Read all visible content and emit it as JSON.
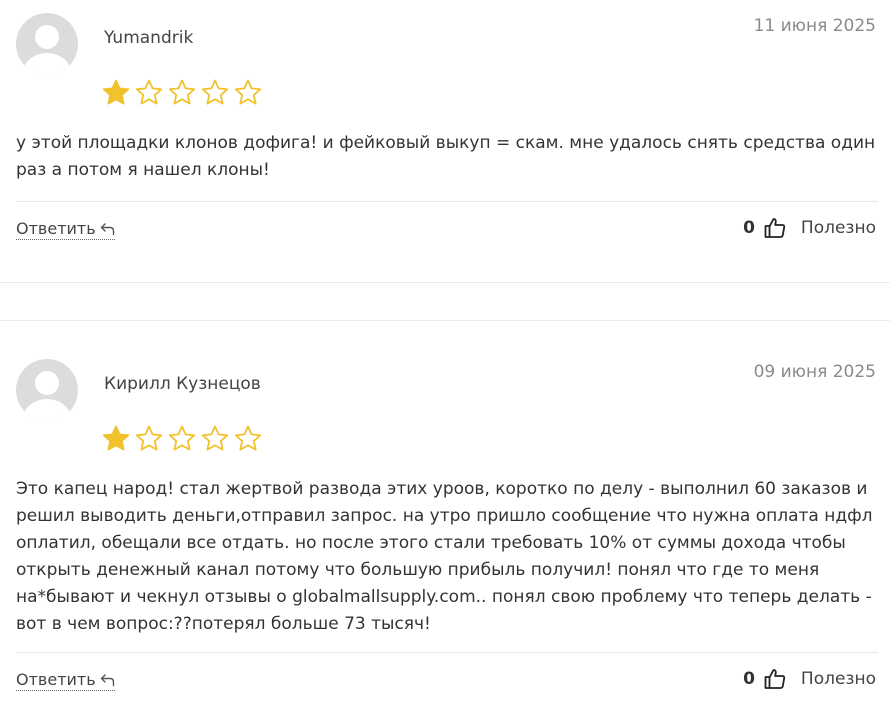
{
  "reviews": [
    {
      "author": "Yumandrik",
      "date": "11 июня 2025",
      "rating": 1,
      "max_rating": 5,
      "text": "у этой площадки клонов дофига! и фейковый выкуп = скам. мне удалось снять средства один раз а потом я нашел клоны!",
      "reply_label": "Ответить",
      "likes": "0",
      "useful_label": "Полезно"
    },
    {
      "author": "Кирилл Кузнецов",
      "date": "09 июня 2025",
      "rating": 1,
      "max_rating": 5,
      "text": "Это капец народ! стал жертвой развода этих уроов, коротко по делу - выполнил 60 заказов и решил выводить деньги,отправил запрос. на утро пришло сообщение что нужна оплата ндфл оплатил, обещали все отдать. но после этого стали требовать 10% от суммы дохода чтобы открыть денежный канал потому что большую прибыль получил! понял что где то меня на*бывают и чекнул отзывы о globalmallsupply.com.. понял свою проблему что теперь делать - вот в чем вопрос:??потерял больше 73 тысяч!",
      "reply_label": "Ответить",
      "likes": "0",
      "useful_label": "Полезно"
    }
  ],
  "colors": {
    "star_filled": "#f2c12e",
    "star_outline": "#f2c12e",
    "avatar_bg": "#dcdcdc",
    "divider": "#e9e9e9"
  },
  "icons": {
    "star": "star-icon",
    "reply": "reply-arrow-icon",
    "like": "thumbs-up-icon",
    "avatar": "user-placeholder-icon"
  }
}
